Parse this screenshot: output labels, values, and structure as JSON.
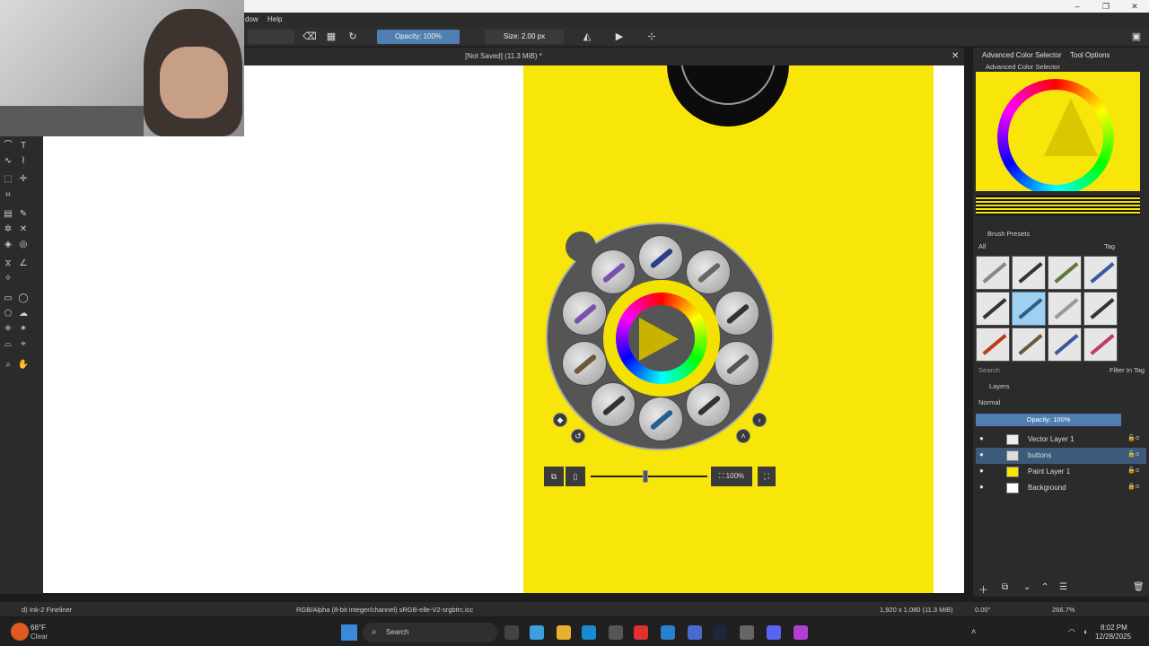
{
  "menu": {
    "window_label": "dow",
    "help_label": "Help"
  },
  "toolbar": {
    "opacity_label": "Opacity: 100%",
    "size_label": "Size: 2.00 px"
  },
  "document": {
    "title": "[Not Saved]  (11.3 MiB) *"
  },
  "palette": {
    "zoom_label": "100%"
  },
  "dock": {
    "tabs": {
      "advanced": "Advanced Color Selector",
      "tool_options": "Tool Options"
    },
    "acs_header": "Advanced Color Selector",
    "brush_header": "Brush Presets",
    "brush_filter_all": "All",
    "brush_tag": "Tag",
    "brush_search_placeholder": "Search",
    "brush_filter_in_tag": "Filter In Tag",
    "layers_header": "Layers",
    "blend_mode": "Normal",
    "layer_opacity": "Opacity:  100%",
    "layers": [
      {
        "name": "Vector Layer 1"
      },
      {
        "name": "buttons"
      },
      {
        "name": "Paint Layer 1"
      },
      {
        "name": "Background"
      }
    ]
  },
  "status": {
    "brush": "d) Ink-2 Fineliner",
    "color_info": "RGB/Alpha (8-bit integer/channel)  sRGB-elle-V2-srgbtrc.icc",
    "dimensions": "1,920 x 1,080 (11.3 MiB)",
    "rotation": "0.00°",
    "zoom": "266.7%"
  },
  "taskbar": {
    "weather_temp": "66°F",
    "weather_desc": "Clear",
    "search_placeholder": "Search",
    "time": "8:02 PM",
    "date": "12/28/2025"
  },
  "colors": {
    "canvas_yellow": "#f8e60a",
    "accent_blue": "#4f7fb0"
  }
}
